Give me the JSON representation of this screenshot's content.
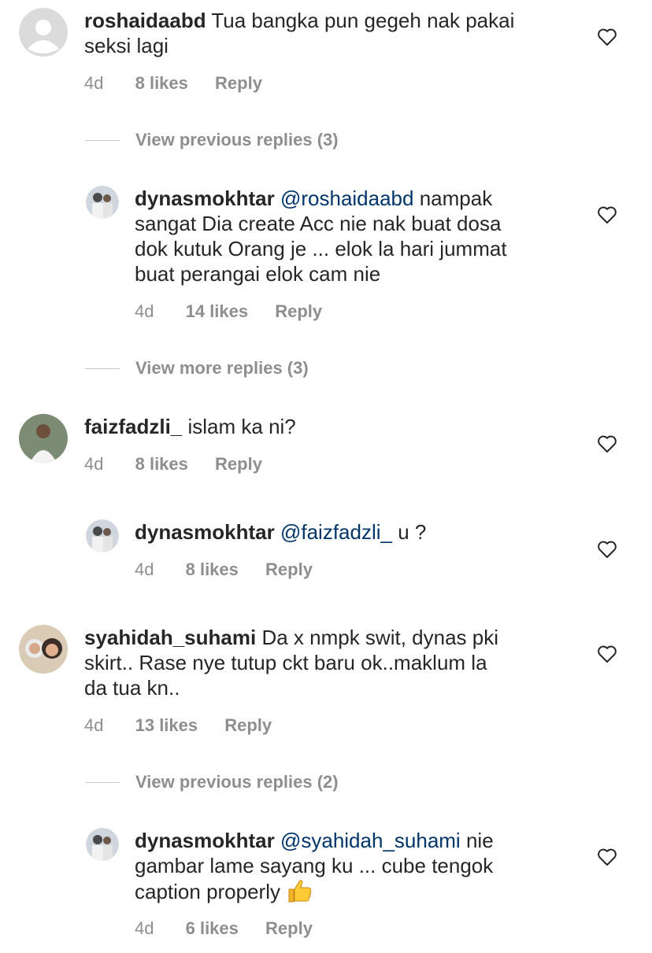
{
  "comments": [
    {
      "username": "roshaidaabd",
      "text": "Tua bangka pun gegeh nak pakai",
      "text2": "seksi lagi",
      "time": "4d",
      "likes": "8 likes",
      "reply": "Reply",
      "view_replies": "View previous replies (3)"
    },
    {
      "username": "dynasmokhtar",
      "mention": "@roshaidaabd",
      "line1": "nampak",
      "line2": "sangat Dia create Acc nie nak buat dosa",
      "line3": "dok kutuk Orang je ... elok la hari jummat",
      "line4": "buat perangai elok cam nie",
      "time": "4d",
      "likes": "14 likes",
      "reply": "Reply",
      "view_replies": "View more replies (3)"
    },
    {
      "username": "faizfadzli_",
      "text": "islam ka ni?",
      "time": "4d",
      "likes": "8 likes",
      "reply": "Reply"
    },
    {
      "username": "dynasmokhtar",
      "mention": "@faizfadzli_",
      "text": "u ?",
      "time": "4d",
      "likes": "8 likes",
      "reply": "Reply"
    },
    {
      "username": "syahidah_suhami",
      "line1": "Da x nmpk swit, dynas pki",
      "line2": "skirt.. Rase nye tutup ckt baru ok..maklum la",
      "line3": "da tua kn..",
      "time": "4d",
      "likes": "13 likes",
      "reply": "Reply",
      "view_replies": "View previous replies (2)"
    },
    {
      "username": "dynasmokhtar",
      "mention": "@syahidah_suhami",
      "line1": "nie",
      "line2": "gambar lame sayang ku ... cube tengok",
      "line3": "caption properly",
      "emoji": "thumbs-up-emoji",
      "time": "4d",
      "likes": "6 likes",
      "reply": "Reply"
    }
  ],
  "colors": {
    "text": "#262626",
    "meta": "#8e8e8e",
    "mention": "#003569",
    "divider": "#c7c7c7"
  },
  "icons": [
    "heart-outline-icon",
    "default-avatar-icon",
    "thumbs-up-emoji"
  ]
}
